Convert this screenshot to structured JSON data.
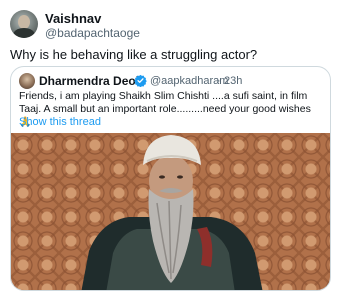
{
  "author": {
    "display_name": "Vaishnav",
    "handle": "@badapachtaoge"
  },
  "tweet": {
    "text": "Why is he behaving like a struggling actor?"
  },
  "quoted_tweet": {
    "display_name": "Dharmendra Deol",
    "verified": true,
    "handle": "@aapkadharam",
    "separator": "·",
    "time": "23h",
    "text": "Friends, i am playing Shaikh Slim Chishti ....a sufi saint, in film Taaj. A small but an important role.........need your good wishes",
    "emoji": "🙏",
    "show_thread_label": "Show this thread"
  },
  "colors": {
    "link": "#1d9bf0",
    "secondary_text": "#536471",
    "border": "#cfd9de"
  }
}
